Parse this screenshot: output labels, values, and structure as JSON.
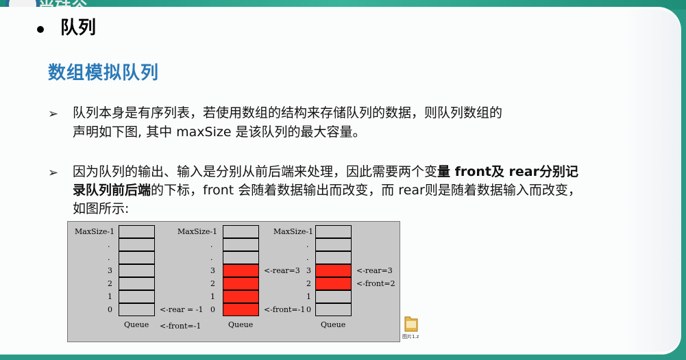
{
  "header": {
    "logo_text": "尚硅谷"
  },
  "slide": {
    "title": "队列",
    "subtitle": "数组模拟队列",
    "points": [
      {
        "marker": "➢",
        "lines": [
          "队列本身是有序列表，若使用数组的结构来存储队列的数据，则队列数组的",
          "声明如下图, 其中 maxSize 是该队列的最大容量。"
        ]
      },
      {
        "marker": "➢",
        "line1_normal": "因为队列的输出、输入是分别从前后端来处理，因此需要两个变",
        "line1_bold": "量 front及 rear分别记",
        "line2_bold": "录队列前后端",
        "line2_normal": "的下标，front 会随着数据输出而改变，而 rear则是随着数据输入而改变，",
        "line3": "如图所示:"
      }
    ]
  },
  "diagram": {
    "row_labels": [
      "MaxSize-1",
      ".",
      ".",
      "3",
      "2",
      "1",
      "0"
    ],
    "queue_label": "Queue",
    "queues": [
      {
        "filled": [],
        "annotations": {
          "rear": "<-rear = -1",
          "front": "<-front=-1"
        }
      },
      {
        "filled": [
          3,
          2,
          1,
          0
        ],
        "annotations": {
          "rear": "<-rear=3",
          "front": "<-front=-1"
        }
      },
      {
        "filled": [
          3,
          2
        ],
        "annotations": {
          "rear": "<-rear=3",
          "front": "<-front=2"
        }
      }
    ],
    "colors": {
      "filled": "#ff2a1a",
      "empty": "#c8c8c8"
    }
  },
  "file": {
    "label": "图片1.z"
  }
}
